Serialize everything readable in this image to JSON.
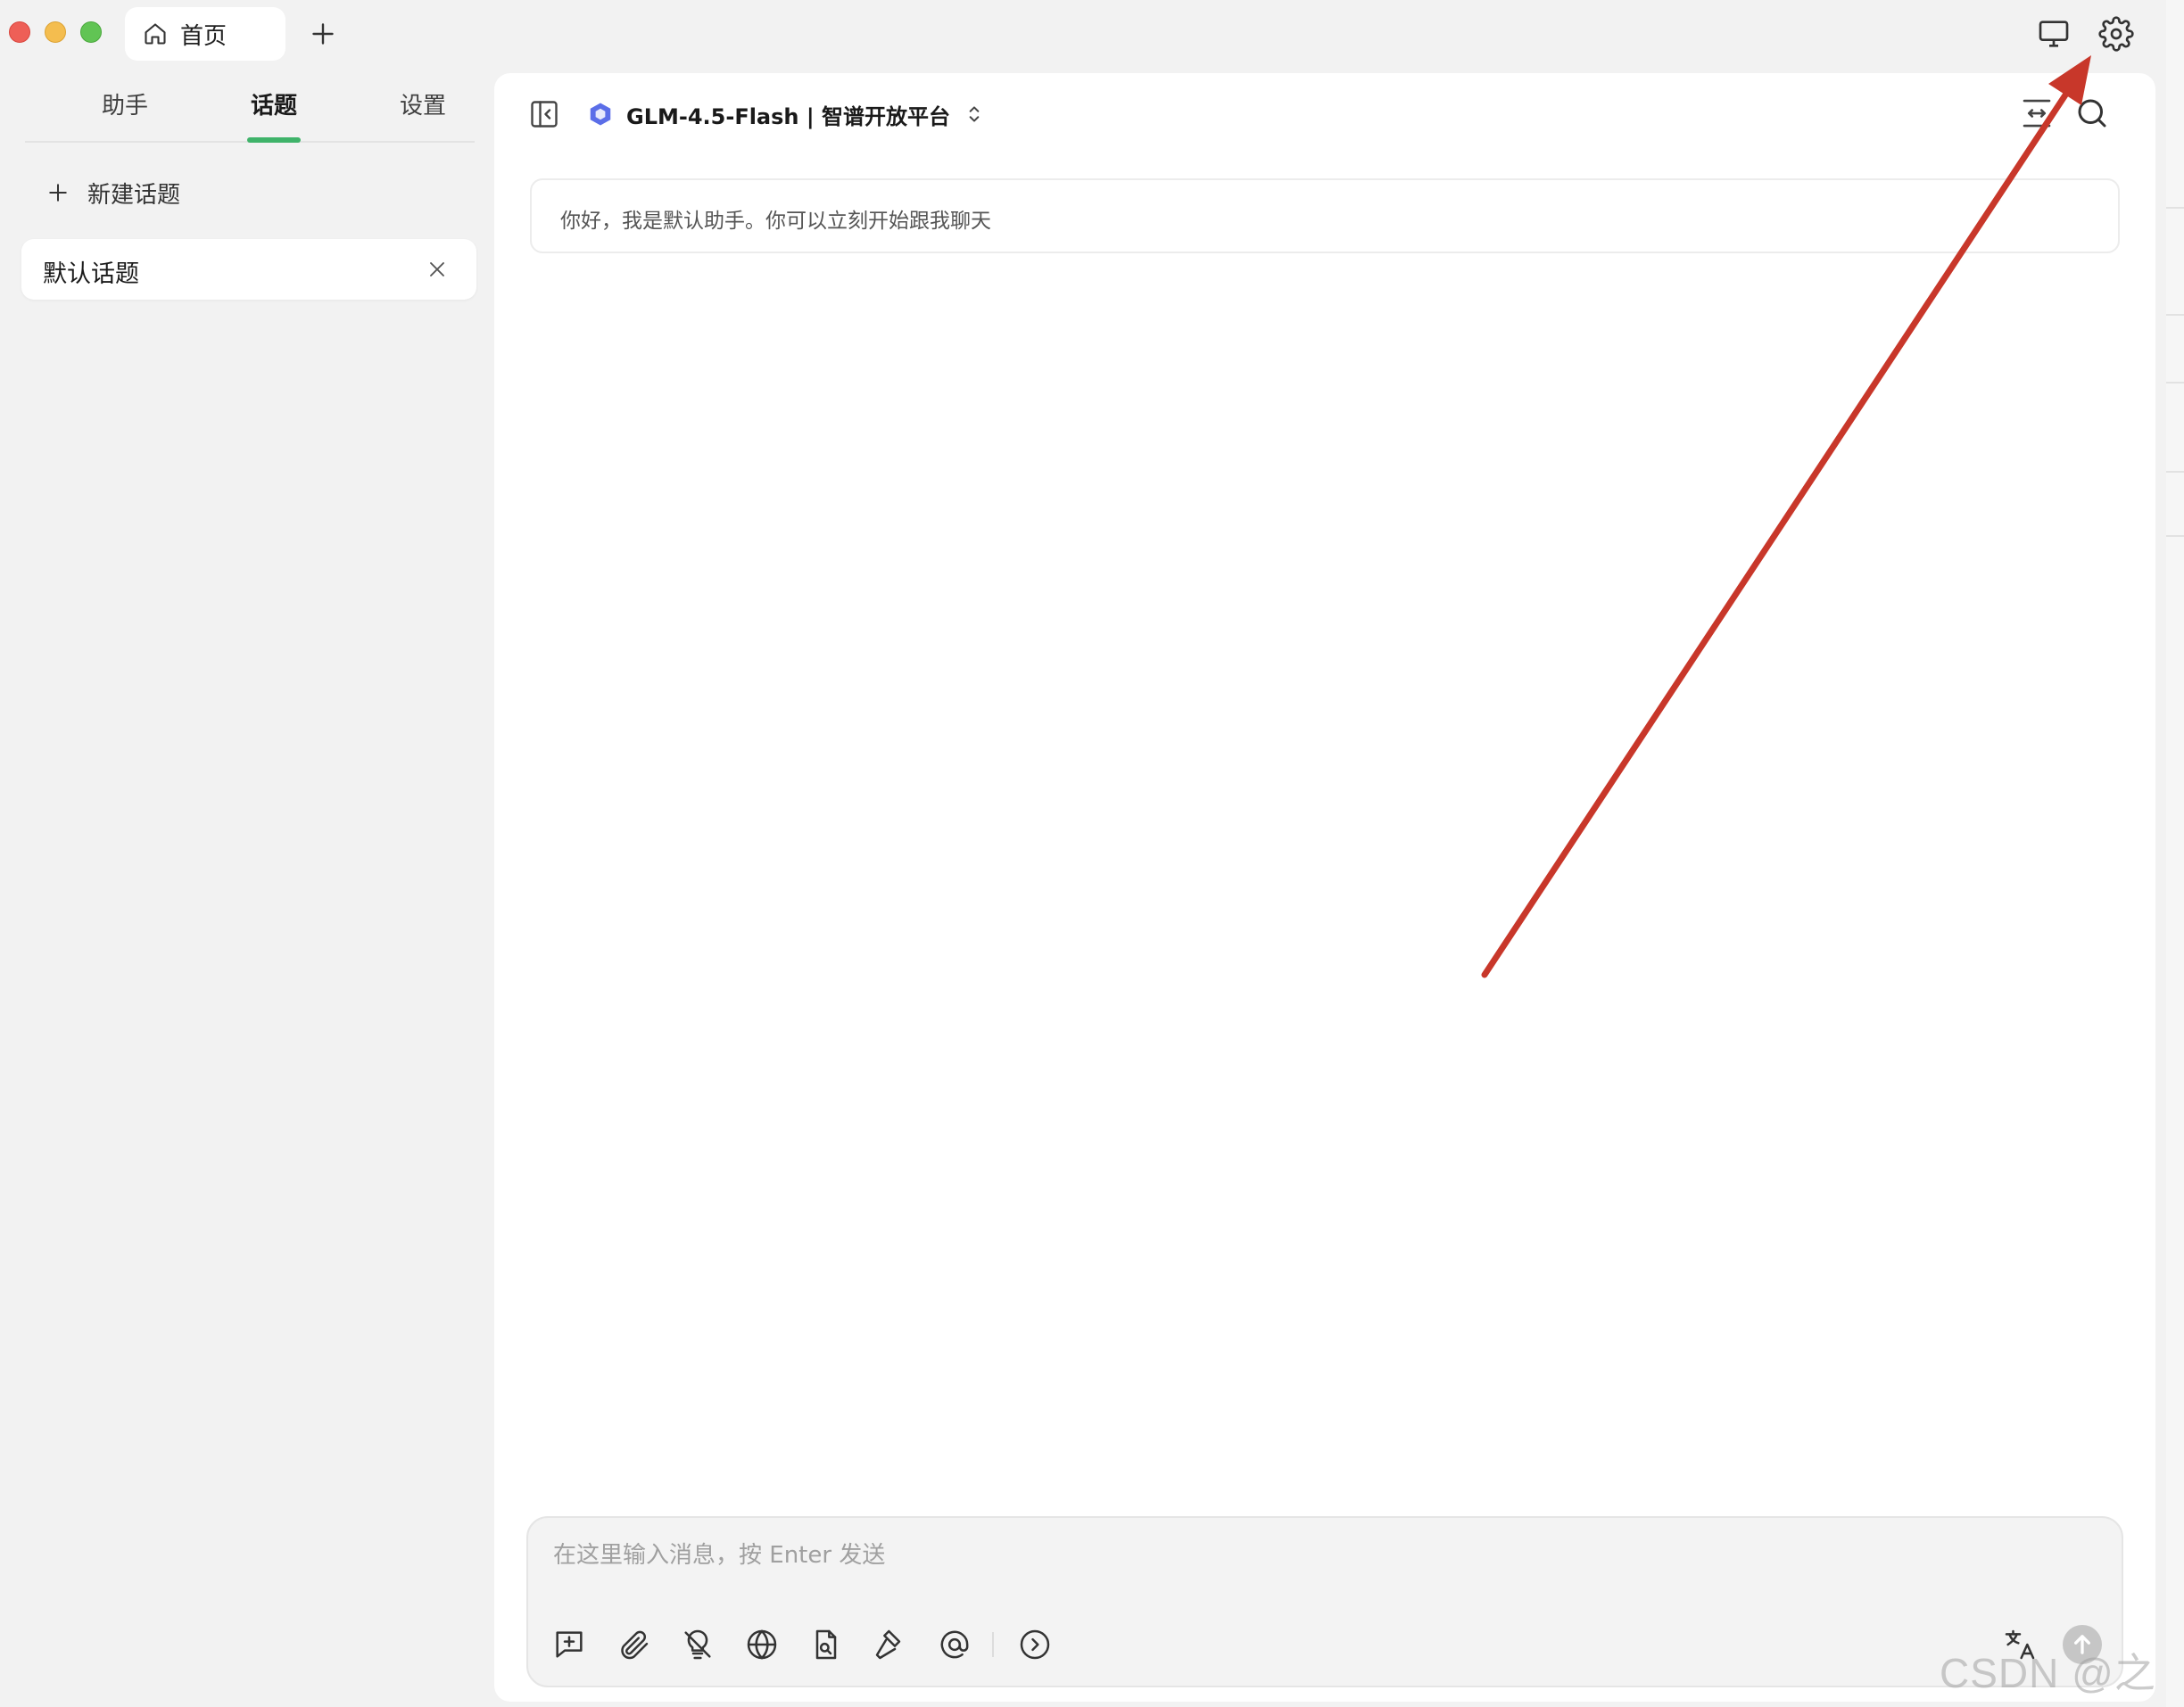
{
  "window": {
    "tab_label": "首页"
  },
  "sidebar": {
    "tabs": [
      {
        "label": "助手"
      },
      {
        "label": "话题"
      },
      {
        "label": "设置"
      }
    ],
    "active_tab": "话题",
    "new_topic_label": "新建话题",
    "topics": [
      {
        "label": "默认话题"
      }
    ]
  },
  "header": {
    "model_label": "GLM-4.5-Flash | 智谱开放平台"
  },
  "chat": {
    "welcome_message": "你好，我是默认助手。你可以立刻开始跟我聊天"
  },
  "composer": {
    "placeholder": "在这里输入消息，按 Enter 发送",
    "value": "",
    "tools": [
      "new-topic-icon",
      "attachment-icon",
      "thinking-off-icon",
      "web-search-icon",
      "knowledge-file-icon",
      "tools-hammer-icon",
      "mention-icon",
      "expand-more-icon"
    ]
  },
  "icons": {
    "home_tab": "home-icon",
    "new_tab": "plus-icon",
    "top_right": [
      "monitor-icon",
      "gear-icon"
    ],
    "header_right": [
      "narrow-mode-icon",
      "search-icon"
    ],
    "composer_right": [
      "translate-icon",
      "send-icon"
    ]
  },
  "colors": {
    "accent_green": "#3fb36a",
    "annotation_arrow": "#c8372a",
    "model_logo": "#5b6ee8"
  },
  "watermark": "CSDN @之歆"
}
